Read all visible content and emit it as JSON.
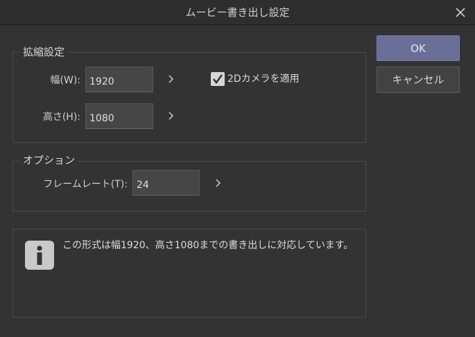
{
  "window": {
    "title": "ムービー書き出し設定"
  },
  "scale": {
    "group_label": "拡縮設定",
    "width": {
      "label": "幅(W):",
      "value": "1920"
    },
    "height": {
      "label": "高さ(H):",
      "value": "1080"
    },
    "camera_2d": {
      "label": "2Dカメラを適用",
      "checked": true
    }
  },
  "options": {
    "group_label": "オプション",
    "framerate": {
      "label": "フレームレート(T):",
      "value": "24"
    }
  },
  "buttons": {
    "ok": "OK",
    "cancel": "キャンセル"
  },
  "info": {
    "message": "この形式は幅1920、高さ1080までの書き出しに対応しています。"
  },
  "icons": {
    "close": "close-icon",
    "arrow": "chevron-right-icon",
    "check": "checkmark-icon",
    "info": "info-icon"
  },
  "colors": {
    "background": "#333333",
    "ok_button": "#6a6f98",
    "field": "#464646"
  }
}
